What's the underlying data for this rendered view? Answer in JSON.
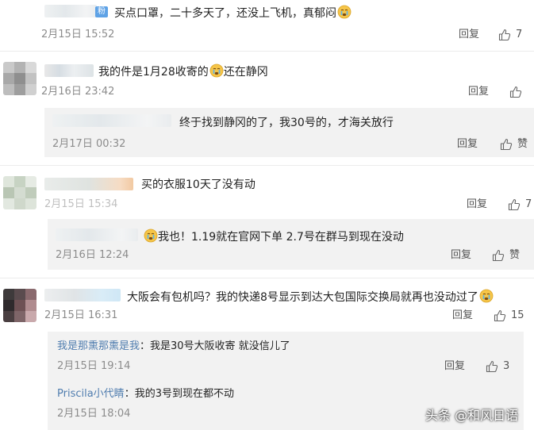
{
  "comments": [
    {
      "text": "买点口罩，二十多天了，还没上飞机，真郁闷",
      "badge": "粉",
      "time": "2月15日 15:52",
      "reply_label": "回复",
      "like_count": "7"
    },
    {
      "text_before_emoji": "我的件是1月28收寄的",
      "text_after_emoji": "还在静冈",
      "time": "2月16日 23:42",
      "reply_label": "回复",
      "like_count": "",
      "sub_replies": [
        {
          "text": "终于找到静冈的了，我30号的，才海关放行",
          "time": "2月17日 00:32",
          "reply_label": "回复",
          "like_count": "赞"
        }
      ]
    },
    {
      "text": "买的衣服10天了没有动",
      "time": "2月15日 15:34",
      "reply_label": "回复",
      "like_count": "7",
      "sub_replies": [
        {
          "text": "我也！1.19就在官网下单 2.7号在群马到现在没动",
          "time": "2月16日 12:24",
          "reply_label": "回复",
          "like_count": "赞"
        }
      ]
    },
    {
      "text": "大阪会有包机吗？我的快递8号显示到达大包国际交换局就再也没动过了",
      "time": "2月15日 16:31",
      "reply_label": "回复",
      "like_count": "15",
      "sub_replies": [
        {
          "author": "我是那熏那熏是我",
          "text": "：我是30号大阪收寄 就没信儿了",
          "time": "2月15日 19:14",
          "reply_label": "回复",
          "like_count": "3"
        },
        {
          "author": "Priscila小代睛",
          "text": "：我的3号到现在都不动",
          "time": "2月15日 18:04",
          "reply_label": "",
          "like_count": ""
        }
      ]
    }
  ],
  "watermark": "头条 @和风日语",
  "colors": {
    "accent_link": "#507daf",
    "sub_bg": "#f2f2f2",
    "time_gray": "#8c8c8c"
  }
}
